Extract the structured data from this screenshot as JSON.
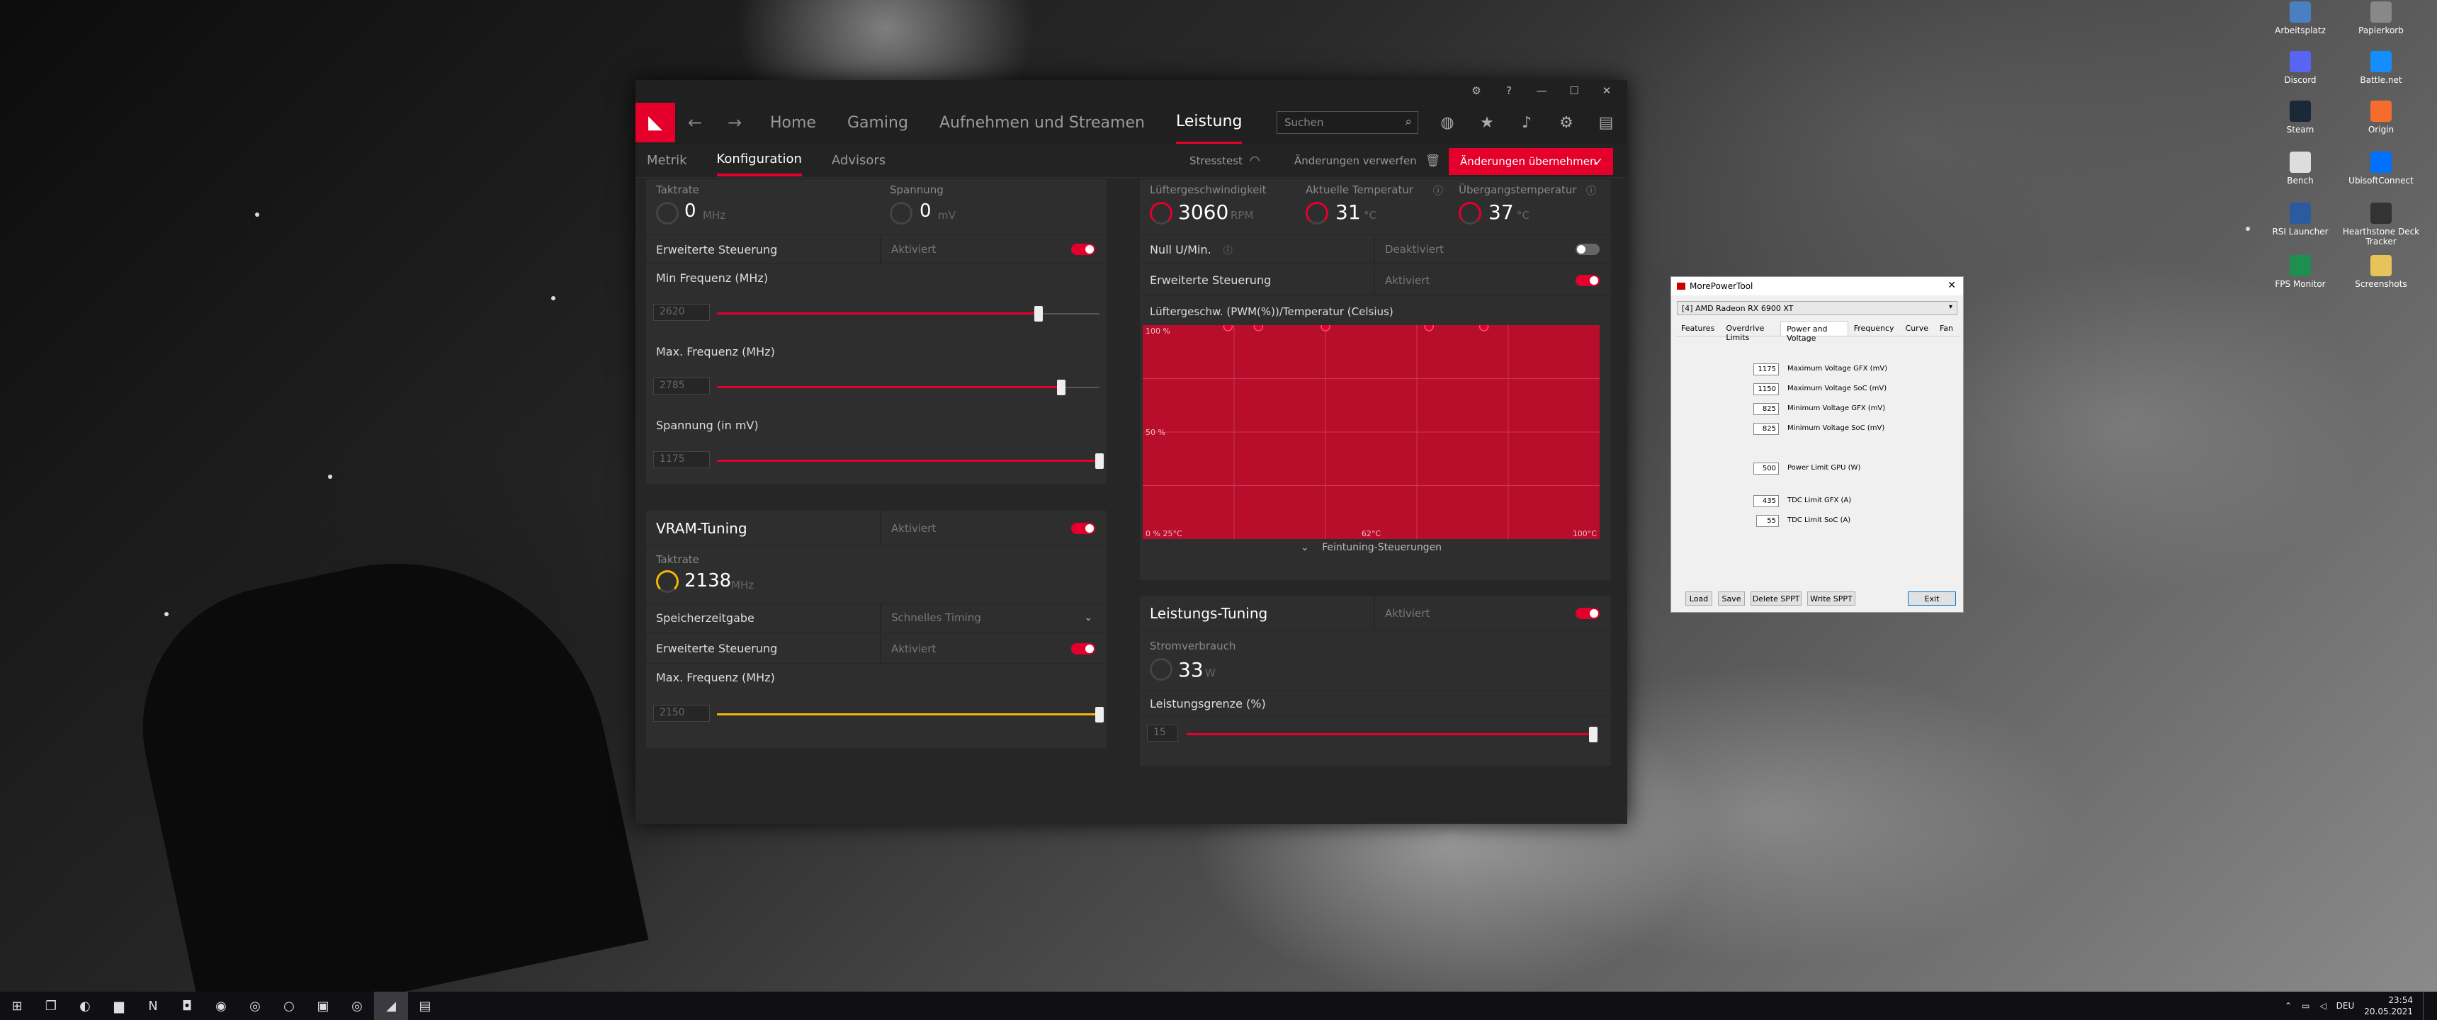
{
  "desktop": {
    "icons": [
      {
        "label": "Arbeitsplatz",
        "icon": "computer-icon",
        "color": "#4a7fc1"
      },
      {
        "label": "Papierkorb",
        "icon": "trash-icon",
        "color": "#888888"
      },
      {
        "label": "Discord",
        "icon": "discord-icon",
        "color": "#5865f2"
      },
      {
        "label": "Battle.net",
        "icon": "battlenet-icon",
        "color": "#148eff"
      },
      {
        "label": "Steam",
        "icon": "steam-icon",
        "color": "#1b2838"
      },
      {
        "label": "Origin",
        "icon": "origin-icon",
        "color": "#f56c2d"
      },
      {
        "label": "Bench",
        "icon": "file-icon",
        "color": "#dddddd"
      },
      {
        "label": "UbisoftConnect",
        "icon": "ubisoft-icon",
        "color": "#0070ff"
      },
      {
        "label": "RSI Launcher",
        "icon": "rsi-icon",
        "color": "#2c5aa0"
      },
      {
        "label": "Hearthstone Deck Tracker",
        "icon": "hdt-icon",
        "color": "#333333"
      },
      {
        "label": "FPS Monitor",
        "icon": "fps-monitor-icon",
        "color": "#1f8f4f"
      },
      {
        "label": "Screenshots",
        "icon": "folder-icon",
        "color": "#e6c45a"
      }
    ]
  },
  "taskbar": {
    "items": [
      {
        "icon": "windows-start-icon",
        "glyph": "⊞"
      },
      {
        "icon": "task-view-icon",
        "glyph": "❐"
      },
      {
        "icon": "edge-icon",
        "glyph": "◐"
      },
      {
        "icon": "explorer-icon",
        "glyph": "▆"
      },
      {
        "icon": "netflix-icon",
        "glyph": "N"
      },
      {
        "icon": "twitch-icon",
        "glyph": "◘"
      },
      {
        "icon": "spotify-icon",
        "glyph": "◉"
      },
      {
        "icon": "chrome-icon",
        "glyph": "◎"
      },
      {
        "icon": "origin-icon",
        "glyph": "○"
      },
      {
        "icon": "messaging-icon",
        "glyph": "▣"
      },
      {
        "icon": "chrome-icon",
        "glyph": "◎"
      },
      {
        "icon": "amd-icon",
        "glyph": "◢"
      },
      {
        "icon": "mpt-icon",
        "glyph": "▤"
      }
    ],
    "tray_lang": "DEU",
    "time": "23:54",
    "date": "20.05.2021"
  },
  "amd": {
    "nav": {
      "home": "Home",
      "gaming": "Gaming",
      "record": "Aufnehmen und Streamen",
      "performance": "Leistung",
      "search_placeholder": "Suchen"
    },
    "subnav": {
      "metrics": "Metrik",
      "config": "Konfiguration",
      "advisors": "Advisors",
      "stresstest": "Stresstest",
      "discard": "Änderungen verwerfen",
      "apply": "Änderungen übernehmen"
    },
    "gpu": {
      "clock_title": "Taktrate",
      "clock_value": "0",
      "clock_unit": "MHz",
      "voltage_title": "Spannung",
      "voltage_value": "0",
      "voltage_unit": "mV",
      "advanced_label": "Erweiterte Steuerung",
      "advanced_value": "Aktiviert",
      "min_freq_label": "Min Frequenz (MHz)",
      "min_freq_value": "2620",
      "min_freq_fraction": 0.84,
      "max_freq_label": "Max. Frequenz (MHz)",
      "max_freq_value": "2785",
      "max_freq_fraction": 0.9,
      "voltage_slider_label": "Spannung (in mV)",
      "voltage_slider_value": "1175",
      "voltage_slider_fraction": 1.0
    },
    "vram": {
      "title": "VRAM-Tuning",
      "status": "Aktiviert",
      "clock_title": "Taktrate",
      "clock_value": "2138",
      "clock_unit": "MHz",
      "timing_label": "Speicherzeitgabe",
      "timing_value": "Schnelles Timing",
      "advanced_label": "Erweiterte Steuerung",
      "advanced_value": "Aktiviert",
      "max_freq_label": "Max. Frequenz (MHz)",
      "max_freq_value": "2150",
      "max_freq_fraction": 1.0
    },
    "fan": {
      "speed_title": "Lüftergeschwindigkeit",
      "speed_value": "3060",
      "speed_unit": "RPM",
      "temp_title": "Aktuelle Temperatur",
      "temp_value": "31",
      "temp_unit": "°C",
      "junction_title": "Übergangstemperatur",
      "junction_value": "37",
      "junction_unit": "°C",
      "zero_rpm_label": "Null U/Min.",
      "zero_rpm_value": "Deaktiviert",
      "advanced_label": "Erweiterte Steuerung",
      "advanced_value": "Aktiviert",
      "curve_title": "Lüftergeschw. (PWM(%))/Temperatur (Celsius)",
      "y_top": "100 %",
      "y_mid": "50 %",
      "x_left": "0 % 25°C",
      "x_mid": "62°C",
      "x_right": "100°C",
      "fine_tuning": "Feintuning-Steuerungen"
    },
    "power": {
      "title": "Leistungs-Tuning",
      "status": "Aktiviert",
      "consumption_title": "Stromverbrauch",
      "consumption_value": "33",
      "consumption_unit": "W",
      "limit_label": "Leistungsgrenze (%)",
      "limit_value": "15",
      "limit_fraction": 1.0
    }
  },
  "chart_data": {
    "type": "line",
    "title": "Lüftergeschw. (PWM(%))/Temperatur (Celsius)",
    "xlabel": "Temperatur (Celsius)",
    "ylabel": "Lüftergeschw. (PWM(%))",
    "xlim": [
      25,
      100
    ],
    "ylim": [
      0,
      100
    ],
    "x": [
      39,
      44,
      55,
      72,
      81
    ],
    "values": [
      100,
      100,
      100,
      100,
      100
    ],
    "fill": true,
    "grid": true
  },
  "mpt": {
    "title": "MorePowerTool",
    "device": "[4] AMD Radeon RX 6900 XT",
    "tabs": [
      "Features",
      "Overdrive Limits",
      "Power and Voltage",
      "Frequency",
      "Curve",
      "Fan"
    ],
    "selected_tab": 2,
    "fields": [
      {
        "value": "1175",
        "label": "Maximum Voltage GFX (mV)"
      },
      {
        "value": "1150",
        "label": "Maximum Voltage SoC (mV)"
      },
      {
        "value": "825",
        "label": "Minimum Voltage GFX (mV)"
      },
      {
        "value": "825",
        "label": "Minimum Voltage SoC (mV)"
      },
      {
        "value": "500",
        "label": "Power Limit GPU (W)"
      },
      {
        "value": "435",
        "label": "TDC Limit GFX (A)"
      },
      {
        "value": "55",
        "label": "TDC Limit SoC (A)"
      }
    ],
    "buttons": {
      "load": "Load",
      "save": "Save",
      "delete": "Delete SPPT",
      "write": "Write SPPT",
      "exit": "Exit"
    }
  }
}
